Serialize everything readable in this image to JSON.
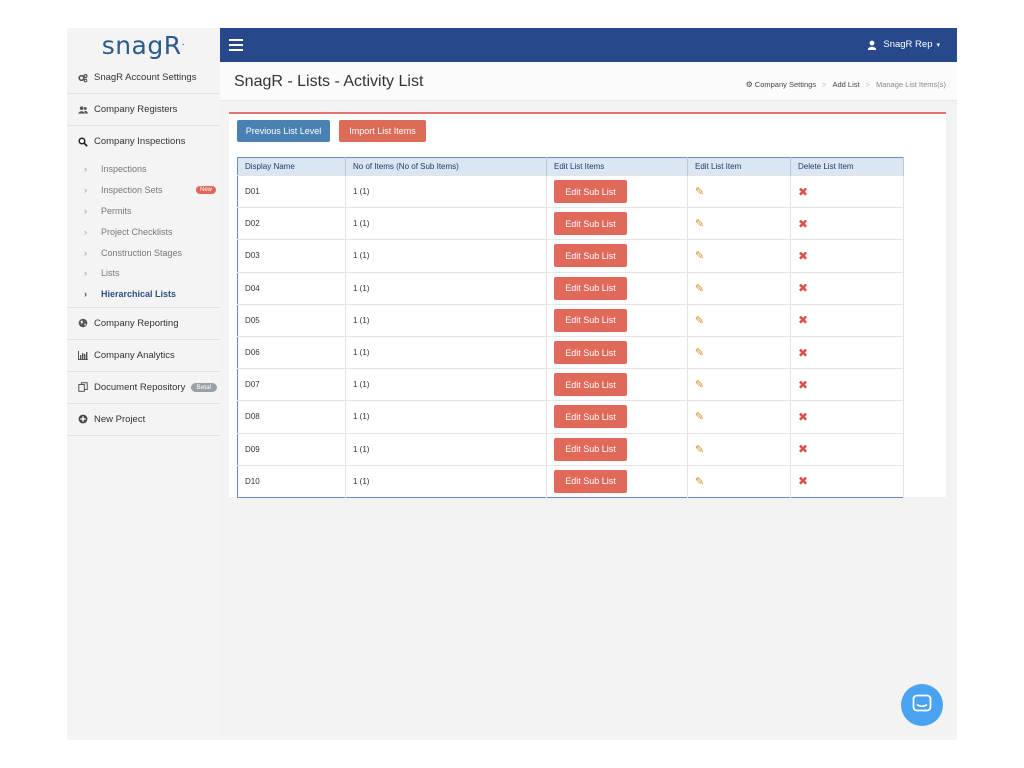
{
  "brand": {
    "logo_text": "snagR",
    "logo_mark": "·"
  },
  "sidebar": {
    "items": [
      {
        "label": "SnagR Account Settings",
        "icon": "cogs-icon"
      },
      {
        "label": "Company Registers",
        "icon": "users-icon"
      },
      {
        "label": "Company Inspections",
        "icon": "search-icon"
      }
    ],
    "sub_items": [
      {
        "label": "Inspections"
      },
      {
        "label": "Inspection Sets",
        "badge": "New"
      },
      {
        "label": "Permits"
      },
      {
        "label": "Project Checklists"
      },
      {
        "label": "Construction Stages"
      },
      {
        "label": "Lists"
      },
      {
        "label": "Hierarchical Lists"
      }
    ],
    "items_after": [
      {
        "label": "Company Reporting",
        "icon": "globe-icon"
      },
      {
        "label": "Company Analytics",
        "icon": "bar-chart-icon"
      },
      {
        "label": "Document Repository",
        "icon": "copy-icon",
        "badge": "Beta!"
      },
      {
        "label": "New Project",
        "icon": "plus-circle-icon"
      }
    ]
  },
  "topbar": {
    "user_name": "SnagR Rep",
    "caret": "▾"
  },
  "header": {
    "title": "SnagR - Lists - Activity List",
    "breadcrumbs": [
      "Company Settings",
      "Add List",
      "Manage List Items(s)"
    ],
    "breadcrumb_sep": ">"
  },
  "toolbar": {
    "previous_label": "Previous List Level",
    "import_label": "Import List Items"
  },
  "table": {
    "headers": [
      "Display Name",
      "No of Items (No of Sub Items)",
      "Edit List Items",
      "Edit List Item",
      "Delete List Item"
    ],
    "edit_sub_label": "Edit Sub List",
    "edit_icon": "✎",
    "delete_icon": "✖",
    "rows": [
      {
        "name": "D01",
        "count": "1 (1)"
      },
      {
        "name": "D02",
        "count": "1 (1)"
      },
      {
        "name": "D03",
        "count": "1 (1)"
      },
      {
        "name": "D04",
        "count": "1 (1)"
      },
      {
        "name": "D05",
        "count": "1 (1)"
      },
      {
        "name": "D06",
        "count": "1 (1)"
      },
      {
        "name": "D07",
        "count": "1 (1)"
      },
      {
        "name": "D08",
        "count": "1 (1)"
      },
      {
        "name": "D09",
        "count": "1 (1)"
      },
      {
        "name": "D10",
        "count": "1 (1)"
      }
    ]
  },
  "colors": {
    "nav_bar": "#27488a",
    "accent_red": "#e0695a",
    "accent_blue": "#4a81b4",
    "chat": "#4aa3f0"
  }
}
